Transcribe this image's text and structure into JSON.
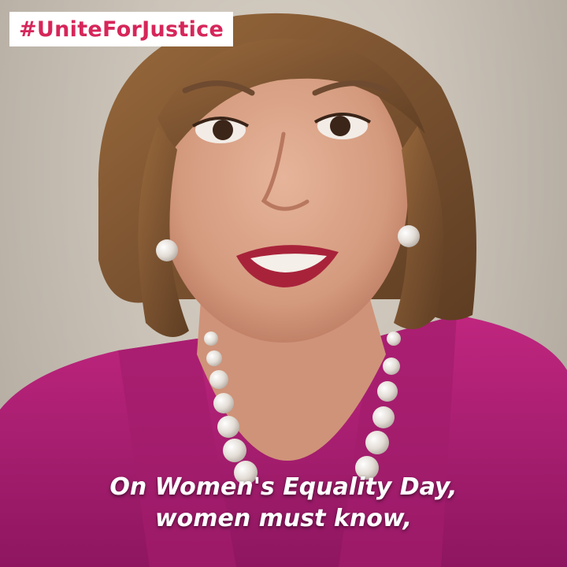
{
  "hashtag": "#UniteForJustice",
  "caption": {
    "line1": "On Women's Equality Day,",
    "line2": "women must know,"
  },
  "colors": {
    "hashtag_text": "#d6265a",
    "hashtag_bg": "#ffffff",
    "caption_text": "#ffffff",
    "jacket": "#b01c72",
    "background": "#cbc3b8"
  }
}
